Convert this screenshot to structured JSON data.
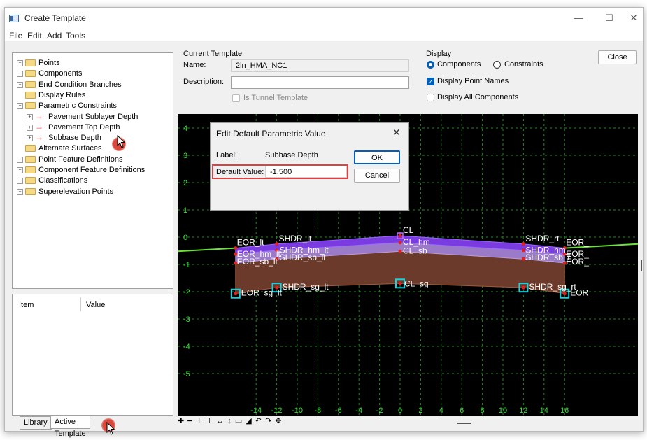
{
  "window": {
    "title": "Create Template",
    "minimize": "—",
    "maximize": "☐",
    "close": "✕"
  },
  "menu": [
    "File",
    "Edit",
    "Add",
    "Tools"
  ],
  "tree": [
    {
      "label": "Points",
      "expander": "+",
      "icon": "folder"
    },
    {
      "label": "Components",
      "expander": "+",
      "icon": "folder"
    },
    {
      "label": "End Condition Branches",
      "expander": "+",
      "icon": "folder"
    },
    {
      "label": "Display Rules",
      "expander": "",
      "icon": "folder"
    },
    {
      "label": "Parametric Constraints",
      "expander": "−",
      "icon": "folder"
    },
    {
      "label": "Pavement Sublayer Depth",
      "expander": "+",
      "icon": "parametric"
    },
    {
      "label": "Pavement Top Depth",
      "expander": "+",
      "icon": "parametric"
    },
    {
      "label": "Subbase Depth",
      "expander": "+",
      "icon": "parametric"
    },
    {
      "label": "Alternate Surfaces",
      "expander": "",
      "icon": "folder"
    },
    {
      "label": "Point Feature Definitions",
      "expander": "+",
      "icon": "folder"
    },
    {
      "label": "Component Feature Definitions",
      "expander": "+",
      "icon": "folder"
    },
    {
      "label": "Classifications",
      "expander": "+",
      "icon": "folder"
    },
    {
      "label": "Superelevation Points",
      "expander": "+",
      "icon": "folder"
    }
  ],
  "properties": {
    "col_item": "Item",
    "col_value": "Value"
  },
  "tabs": [
    "Library",
    "Active Template"
  ],
  "current_template": {
    "heading": "Current Template",
    "name_label": "Name:",
    "name_value": "2ln_HMA_NC1",
    "description_label": "Description:",
    "description_value": "",
    "tunnel_label": "Is Tunnel Template",
    "tunnel_checked": false
  },
  "display": {
    "heading": "Display",
    "components_label": "Components",
    "constraints_label": "Constraints",
    "selected": "Components",
    "point_names_label": "Display Point Names",
    "point_names_checked": true,
    "all_components_label": "Display All Components",
    "all_components_checked": false
  },
  "close_button": "Close",
  "dialog": {
    "title": "Edit Default Parametric Value",
    "label_caption": "Label:",
    "label_value": "Subbase Depth",
    "default_caption": "Default Value:",
    "default_value": "-1.500",
    "ok": "OK",
    "cancel": "Cancel",
    "close": "✕"
  },
  "canvas": {
    "y_ticks": [
      "4",
      "3",
      "2",
      "1",
      "0",
      "-1",
      "-2",
      "-3",
      "-4",
      "-5"
    ],
    "x_ticks": [
      "-14",
      "-12",
      "-10",
      "-8",
      "-6",
      "-4",
      "-2",
      "0",
      "2",
      "4",
      "6",
      "8",
      "10",
      "12",
      "14",
      "16"
    ],
    "point_labels": {
      "eor_lt": "EOR_lt",
      "eor_hm_lt": "EOR_hm_lt",
      "eor_sb_lt": "EOR_sb_lt",
      "eor_sg_lt": "EOR_sg_lt",
      "shdr_lt": "SHDR_lt",
      "shdr_hm_lt": "SHDR_hm_lt",
      "shdr_sb_lt": "SHDR_sb_lt",
      "shdr_sg_lt": "SHDR_sg_lt",
      "cl": "CL",
      "cl_hm": "CL_hm",
      "cl_sb": "CL_sb",
      "cl_sg": "CL_sg",
      "shdr_rt": "SHDR_rt",
      "shdr_hm_rt": "SHDR_hm_",
      "shdr_sb_rt": "SHDR_sb_r",
      "shdr_sg_rt": "SHDR_sg_rt",
      "eor_rt": "EOR_",
      "eor_hm_rt": "EOR_",
      "eor_sb_rt": "EOR_",
      "eor_sg_rt": "EOR_"
    },
    "colors": {
      "background": "#000000",
      "grid": "#1f8a1f",
      "tick_text": "#35e035",
      "pavement_top": "#7a3be0",
      "pavement_sublayer": "#8e58d8",
      "subbase": "#9b7bc8",
      "subgrade": "#6b3a2a",
      "point": "#e02020",
      "selected_point": "#15d4e0",
      "label_text": "#ffffff"
    }
  },
  "toolstrip": "✚ ━ ⊥ ⊤ ↔ ↕ ▭ ◢ ↶ ↷ ✥"
}
